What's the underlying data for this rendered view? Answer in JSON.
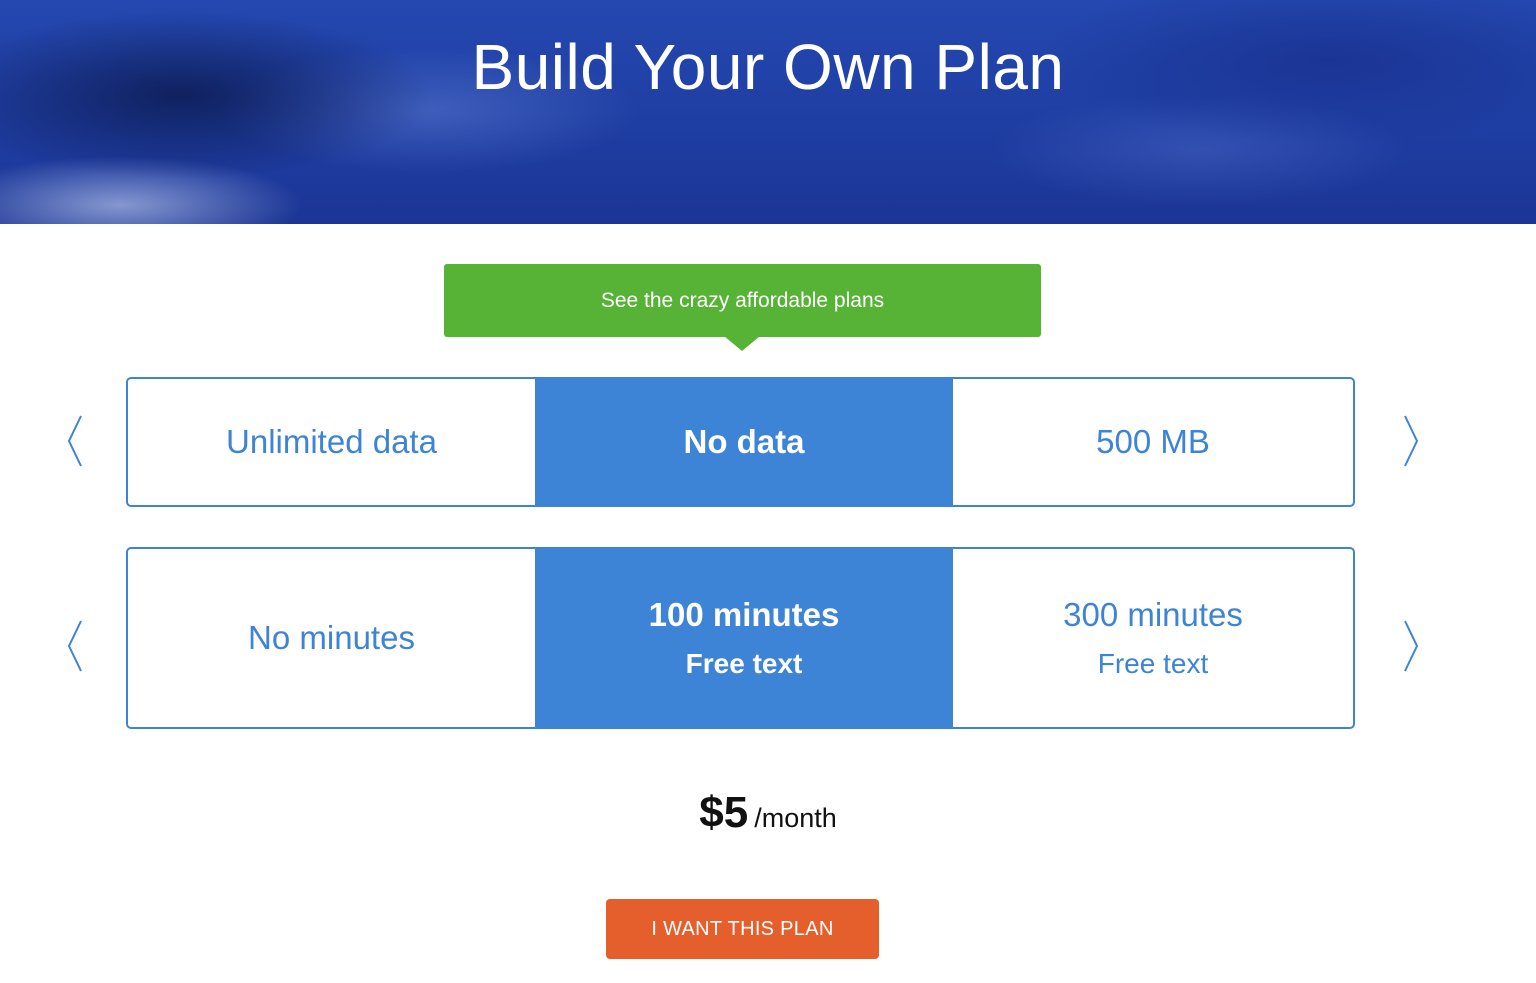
{
  "hero": {
    "title": "Build Your Own Plan"
  },
  "callout": {
    "text": "See the crazy affordable plans"
  },
  "data_selector": {
    "options": [
      {
        "label": "Unlimited data"
      },
      {
        "label": "No data",
        "selected": true
      },
      {
        "label": "500 MB"
      }
    ],
    "prev_icon": "chevron-left-icon",
    "next_icon": "chevron-right-icon"
  },
  "minutes_selector": {
    "options": [
      {
        "label": "No minutes"
      },
      {
        "label": "100 minutes",
        "sub": "Free text",
        "selected": true
      },
      {
        "label": "300 minutes",
        "sub": "Free text"
      }
    ],
    "prev_icon": "chevron-left-icon",
    "next_icon": "chevron-right-icon"
  },
  "price": {
    "amount": "$5",
    "period": "/month"
  },
  "cta": {
    "label": "I WANT THIS PLAN"
  },
  "colors": {
    "accent_blue": "#3d84d6",
    "callout_green": "#56b335",
    "cta_orange": "#e45f2b",
    "hero_blue": "#1f3ea3"
  }
}
